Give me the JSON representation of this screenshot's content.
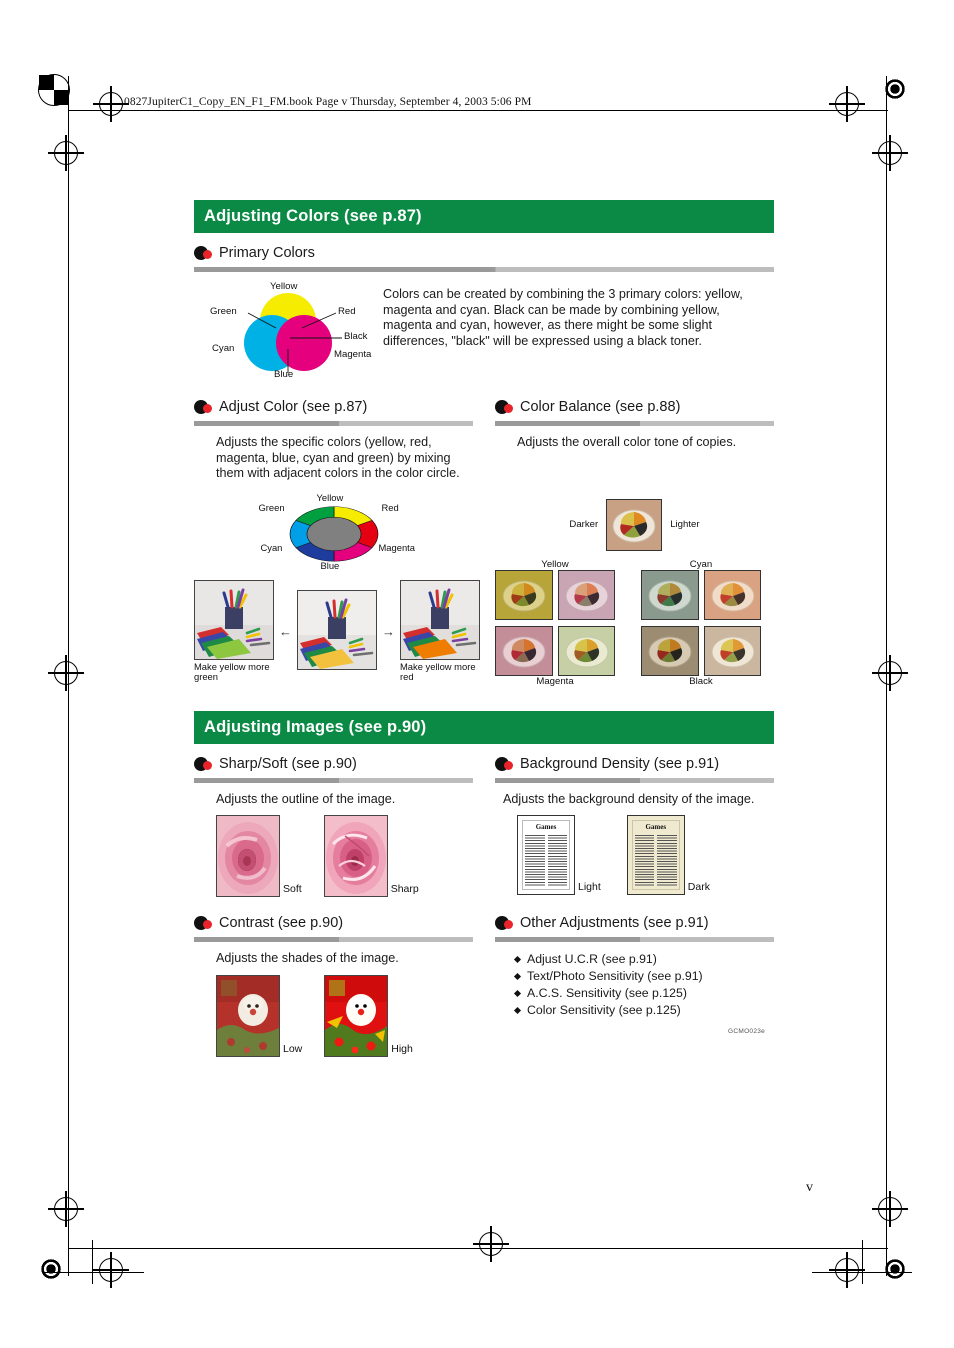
{
  "document": {
    "file_header": "0827JupiterC1_Copy_EN_F1_FM.book  Page v  Thursday, September 4, 2003  5:06 PM",
    "folio": "v",
    "figure_code": "GCMO023e"
  },
  "colors": {
    "banner_green": "#0b8a46",
    "rule_gray": "#9a9a9a",
    "bullet_black": "#111111",
    "bullet_red": "#e8232a"
  },
  "sections": [
    {
      "banner": "Adjusting Colors (see p.87)",
      "subsections": [
        {
          "title": "Primary Colors",
          "body": "Colors can be created by combining the 3 primary colors: yellow, magenta and cyan. Black can be made by combining yellow, magenta and cyan, however, as there might be some slight differences, \"black\" will be expressed using a black toner.",
          "diagram_labels": [
            "Yellow",
            "Green",
            "Red",
            "Black",
            "Cyan",
            "Magenta",
            "Blue"
          ]
        },
        {
          "title": "Adjust Color (see p.87)",
          "body": "Adjusts the specific colors (yellow, red, magenta, blue, cyan and green) by mixing them with adjacent colors in the color circle.",
          "wheel_labels": [
            "Yellow",
            "Red",
            "Magenta",
            "Blue",
            "Cyan",
            "Green"
          ],
          "photo_captions": [
            "Make yellow more green",
            "",
            "Make yellow more red"
          ],
          "arrows": [
            "←",
            "→"
          ]
        },
        {
          "title": "Color Balance (see p.88)",
          "body": "Adjusts the overall color tone of copies.",
          "center_labels": [
            "Darker",
            "Lighter"
          ],
          "group_labels": [
            "Yellow",
            "Cyan",
            "Magenta",
            "Black"
          ]
        }
      ]
    },
    {
      "banner": "Adjusting Images (see p.90)",
      "subsections": [
        {
          "title": "Sharp/Soft (see p.90)",
          "body": "Adjusts the outline of the image.",
          "image_labels": [
            "Soft",
            "Sharp"
          ]
        },
        {
          "title": "Background Density (see p.91)",
          "body": "Adjusts the background density of the image.",
          "image_labels": [
            "Light",
            "Dark"
          ],
          "doc_heading": "Games"
        },
        {
          "title": "Contrast (see p.90)",
          "body": "Adjusts the shades of the image.",
          "image_labels": [
            "Low",
            "High"
          ]
        },
        {
          "title": "Other Adjustments (see p.91)",
          "items": [
            "Adjust U.C.R (see p.91)",
            "Text/Photo Sensitivity (see p.91)",
            "A.C.S. Sensitivity (see p.125)",
            "Color Sensitivity  (see p.125)"
          ]
        }
      ]
    }
  ]
}
